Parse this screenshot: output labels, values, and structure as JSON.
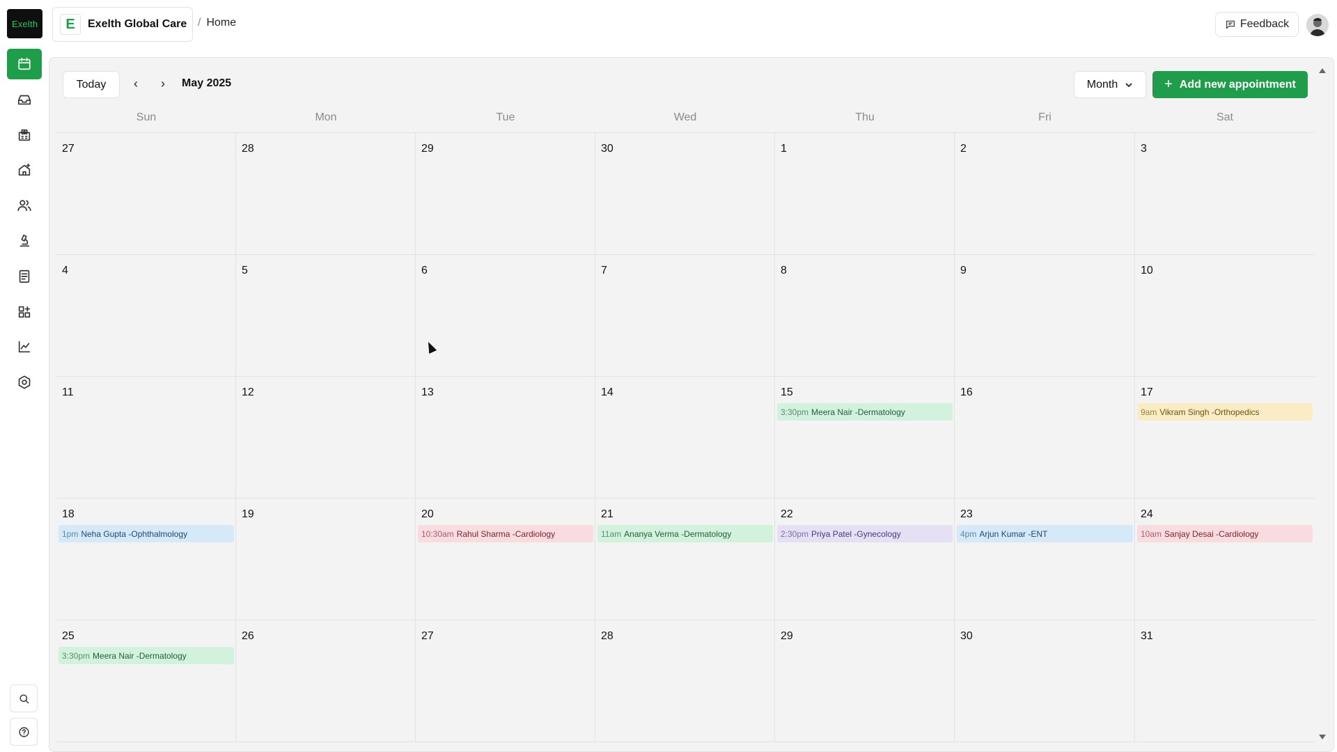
{
  "sidebar": {
    "logo_text": "Exelth",
    "items": [
      {
        "icon": "calendar-icon",
        "active": true
      },
      {
        "icon": "inbox-icon",
        "active": false
      },
      {
        "icon": "hospital-icon",
        "active": false
      },
      {
        "icon": "clinic-add-icon",
        "active": false
      },
      {
        "icon": "users-icon",
        "active": false
      },
      {
        "icon": "microscope-icon",
        "active": false
      },
      {
        "icon": "document-icon",
        "active": false
      },
      {
        "icon": "grid-plus-icon",
        "active": false
      },
      {
        "icon": "chart-icon",
        "active": false
      },
      {
        "icon": "settings-hex-icon",
        "active": false
      }
    ],
    "bottom": [
      {
        "icon": "search-icon"
      },
      {
        "icon": "help-icon"
      }
    ]
  },
  "header": {
    "brand_initial": "E",
    "brand_name": "Exelth Global Care",
    "breadcrumb_sep": "/",
    "breadcrumb_page": "Home",
    "feedback_label": "Feedback"
  },
  "toolbar": {
    "today_label": "Today",
    "prev": "‹",
    "next": "›",
    "month_label": "May 2025",
    "view_label": "Month",
    "add_label": "Add new appointment"
  },
  "weekdays": [
    "Sun",
    "Mon",
    "Tue",
    "Wed",
    "Thu",
    "Fri",
    "Sat"
  ],
  "weeks": [
    [
      {
        "day": "27"
      },
      {
        "day": "28"
      },
      {
        "day": "29"
      },
      {
        "day": "30"
      },
      {
        "day": "1"
      },
      {
        "day": "2"
      },
      {
        "day": "3"
      }
    ],
    [
      {
        "day": "4"
      },
      {
        "day": "5"
      },
      {
        "day": "6"
      },
      {
        "day": "7"
      },
      {
        "day": "8"
      },
      {
        "day": "9"
      },
      {
        "day": "10"
      }
    ],
    [
      {
        "day": "11"
      },
      {
        "day": "12"
      },
      {
        "day": "13"
      },
      {
        "day": "14"
      },
      {
        "day": "15",
        "event": {
          "time": "3:30pm",
          "title": "Meera Nair -Dermatology",
          "color": "green"
        }
      },
      {
        "day": "16"
      },
      {
        "day": "17",
        "event": {
          "time": "9am",
          "title": "Vikram Singh -Orthopedics",
          "color": "yellow"
        }
      }
    ],
    [
      {
        "day": "18",
        "event": {
          "time": "1pm",
          "title": "Neha Gupta -Ophthalmology",
          "color": "blue"
        }
      },
      {
        "day": "19"
      },
      {
        "day": "20",
        "event": {
          "time": "10:30am",
          "title": "Rahul Sharma -Cardiology",
          "color": "red"
        }
      },
      {
        "day": "21",
        "event": {
          "time": "11am",
          "title": "Ananya Verma -Dermatology",
          "color": "green"
        }
      },
      {
        "day": "22",
        "event": {
          "time": "2:30pm",
          "title": "Priya Patel -Gynecology",
          "color": "purple"
        }
      },
      {
        "day": "23",
        "event": {
          "time": "4pm",
          "title": "Arjun Kumar -ENT",
          "color": "blue"
        }
      },
      {
        "day": "24",
        "event": {
          "time": "10am",
          "title": "Sanjay Desai -Cardiology",
          "color": "red"
        }
      }
    ],
    [
      {
        "day": "25",
        "event": {
          "time": "3:30pm",
          "title": "Meera Nair -Dermatology",
          "color": "green"
        }
      },
      {
        "day": "26"
      },
      {
        "day": "27"
      },
      {
        "day": "28"
      },
      {
        "day": "29"
      },
      {
        "day": "30"
      },
      {
        "day": "31"
      }
    ]
  ],
  "colors": {
    "accent": "#1f9d4a",
    "event_green": "#d3f2de",
    "event_yellow": "#faecc4",
    "event_blue": "#d6e9f8",
    "event_red": "#f8dcdf",
    "event_purple": "#e6e0f5"
  }
}
